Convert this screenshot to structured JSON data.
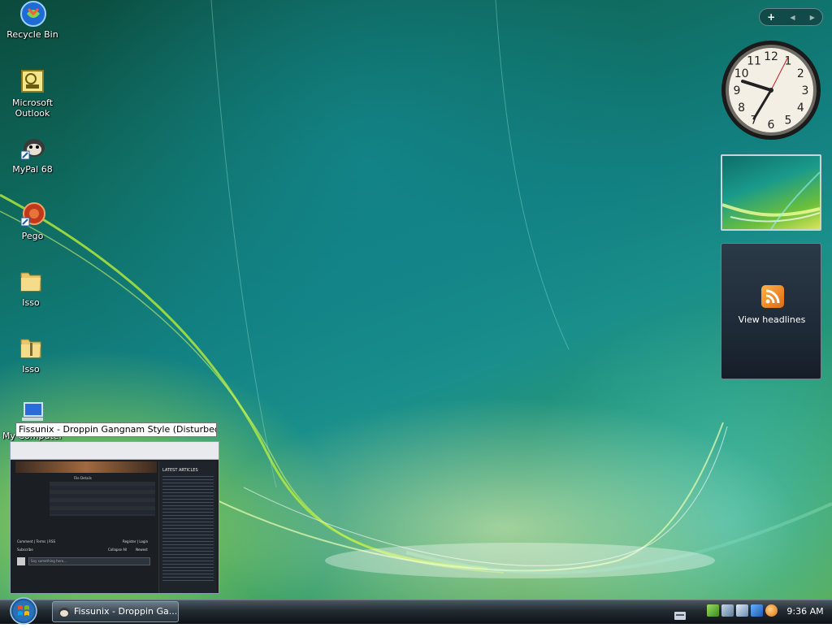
{
  "desktop": {
    "icons": [
      {
        "label": "Recycle Bin"
      },
      {
        "label": "Microsoft Outlook"
      },
      {
        "label": "MyPal 68"
      },
      {
        "label": "Pego"
      },
      {
        "label": "Isso"
      },
      {
        "label": "Isso"
      },
      {
        "label": "My Computer"
      }
    ]
  },
  "gadgets": {
    "toolbar": {
      "add": "+",
      "prev": "◀",
      "next": "▶"
    },
    "clock": {
      "numbers": [
        "12",
        "1",
        "2",
        "3",
        "4",
        "5",
        "6",
        "7",
        "8",
        "9",
        "10",
        "11"
      ]
    },
    "feed": {
      "label": "View headlines"
    }
  },
  "tooltip": {
    "text": "Fissunix - Droppin Gangnam Style (Disturbed ..."
  },
  "preview": {
    "sidebar_title": "LATEST ARTICLES",
    "file_details_title": "File Details",
    "comment_bar": "Comment | Terms | RSS",
    "register_login": "Register | Login",
    "subscribe": "Subscribe",
    "collapse": "Collapse All",
    "newest": "Newest",
    "say_placeholder": "Say something here..."
  },
  "taskbar": {
    "task_label": "Fissunix - Droppin Ga...",
    "time": "9:36 AM"
  },
  "colors": {
    "accent": "#1a8f8a",
    "rss": "#f08a24"
  }
}
